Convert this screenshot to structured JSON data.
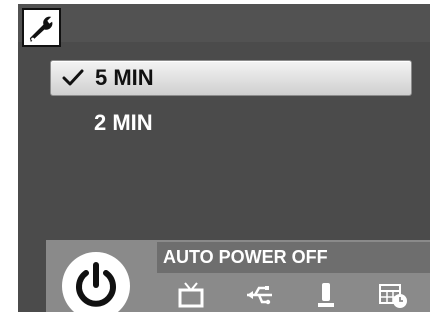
{
  "menu": {
    "options": [
      {
        "label": "5 MIN",
        "selected": true,
        "check_mark": "✓"
      },
      {
        "label": "2 MIN",
        "selected": false,
        "check_mark": ""
      }
    ]
  },
  "info_bar": {
    "title": "AUTO POWER OFF"
  },
  "header": {
    "active_tab_icon": "wrench-icon"
  },
  "bottom_icons": [
    "power-icon",
    "tv-icon",
    "usb-icon",
    "microphone-icon",
    "calendar-clock-icon"
  ],
  "colors": {
    "screen_bg": "#4b4b4b",
    "panel_bg": "#8a8a8a",
    "info_bar_bg": "#6e6e6e",
    "selection_bg": "#e6e6e6",
    "text_light": "#ffffff",
    "text_dark": "#111111"
  }
}
